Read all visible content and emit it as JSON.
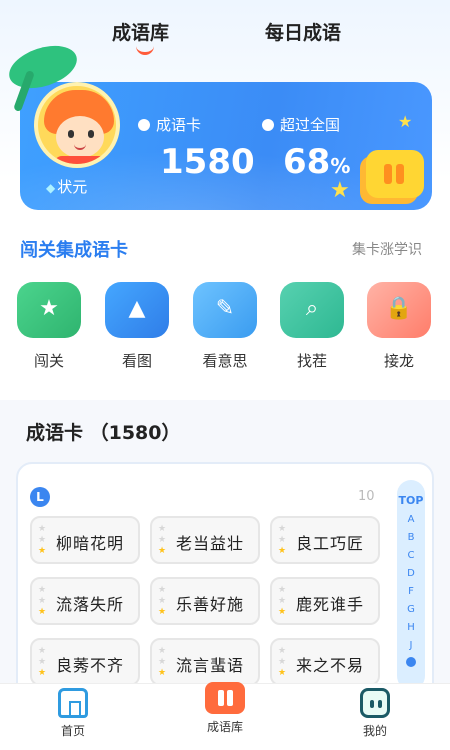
{
  "tabs": [
    {
      "label": "成语库",
      "active": true
    },
    {
      "label": "每日成语",
      "active": false
    }
  ],
  "profile": {
    "rank": "状元",
    "stats": [
      {
        "label": "成语卡",
        "value": "1580",
        "suffix": ""
      },
      {
        "label": "超过全国",
        "value": "68",
        "suffix": "%"
      }
    ]
  },
  "collect_section": {
    "title": "闯关集成语卡",
    "link": "集卡涨学识",
    "features": [
      {
        "label": "闯关",
        "icon": "star-card-icon",
        "glyph": "★"
      },
      {
        "label": "看图",
        "icon": "picture-icon",
        "glyph": "▲"
      },
      {
        "label": "看意思",
        "icon": "scroll-icon",
        "glyph": "✎"
      },
      {
        "label": "找茬",
        "icon": "magnifier-icon",
        "glyph": "⌕"
      },
      {
        "label": "接龙",
        "icon": "lock-icon",
        "glyph": "🔒"
      }
    ]
  },
  "card_list": {
    "title": "成语卡 （1580）",
    "group_letter": "L",
    "group_count": "10",
    "cards": [
      {
        "text": "柳暗花明",
        "stars": 1
      },
      {
        "text": "老当益壮",
        "stars": 1
      },
      {
        "text": "良工巧匠",
        "stars": 1
      },
      {
        "text": "流落失所",
        "stars": 1
      },
      {
        "text": "乐善好施",
        "stars": 1
      },
      {
        "text": "鹿死谁手",
        "stars": 1
      },
      {
        "text": "良莠不齐",
        "stars": 1
      },
      {
        "text": "流言蜚语",
        "stars": 1
      },
      {
        "text": "来之不易",
        "stars": 1
      }
    ],
    "index": {
      "top": "TOP",
      "letters": [
        "A",
        "B",
        "C",
        "D",
        "F",
        "G",
        "H",
        "J"
      ]
    }
  },
  "bottom_nav": [
    {
      "label": "首页",
      "icon": "home-icon"
    },
    {
      "label": "成语库",
      "icon": "idiom-library-icon"
    },
    {
      "label": "我的",
      "icon": "profile-icon"
    }
  ],
  "colors": {
    "accent": "#3b86f0",
    "tab_underline": "#ff5b3a",
    "star": "#ffc21a"
  }
}
